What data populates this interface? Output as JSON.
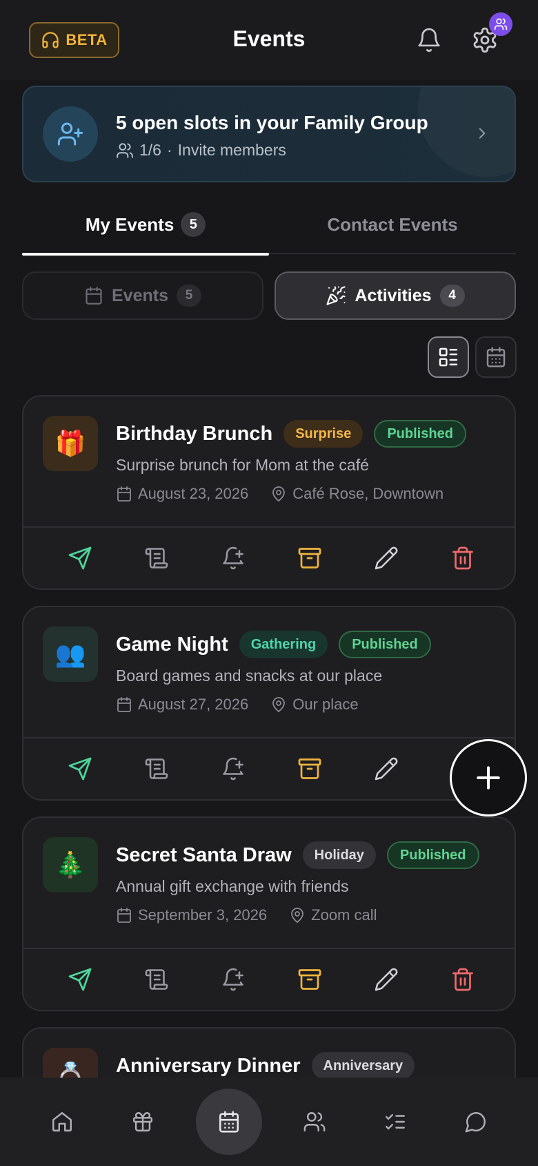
{
  "header": {
    "beta_label": "BETA",
    "title": "Events",
    "icons": [
      "headset-icon",
      "bell-icon",
      "gear-icon",
      "users-badge-icon"
    ]
  },
  "banner": {
    "title": "5 open slots in your Family Group",
    "count": "1/6",
    "separator": "·",
    "link": "Invite members"
  },
  "tabs": [
    {
      "label": "My Events",
      "count": "5",
      "active": true
    },
    {
      "label": "Contact Events",
      "active": false
    }
  ],
  "segments": [
    {
      "label": "Events",
      "count": "5",
      "active": false
    },
    {
      "label": "Activities",
      "count": "4",
      "active": true
    }
  ],
  "view_toggle": {
    "selected": "list",
    "options": [
      "list",
      "calendar"
    ]
  },
  "cards": [
    {
      "emoji": "🎁",
      "title": "Birthday Brunch",
      "category": "Surprise",
      "status": "Published",
      "description": "Surprise brunch for Mom at the café",
      "date": "August 23, 2026",
      "location": "Café Rose, Downtown"
    },
    {
      "emoji": "👥",
      "title": "Game Night",
      "category": "Gathering",
      "status": "Published",
      "description": "Board games and snacks at our place",
      "date": "August 27, 2026",
      "location": "Our place"
    },
    {
      "emoji": "🎄",
      "title": "Secret Santa Draw",
      "category": "Holiday",
      "status": "Published",
      "description": "Annual gift exchange with friends",
      "date": "September 3, 2026",
      "location": "Zoom call"
    },
    {
      "emoji": "💍",
      "title": "Anniversary Dinner",
      "category": "Anniversary"
    }
  ],
  "card_actions": [
    "send",
    "receipt",
    "reminder",
    "archive",
    "edit",
    "delete"
  ],
  "bottom_nav": [
    {
      "name": "home",
      "active": false
    },
    {
      "name": "gifts",
      "active": false
    },
    {
      "name": "events",
      "active": true
    },
    {
      "name": "contacts",
      "active": false
    },
    {
      "name": "tasks",
      "active": false
    },
    {
      "name": "chat",
      "active": false
    }
  ],
  "colors": {
    "background": "#17171a",
    "accent_gold": "#f0b43c",
    "published_green": "#5fd494",
    "delete_red": "#f06a6a",
    "send_green": "#4fd69a",
    "archive_gold": "#f0b43c",
    "badge_purple": "#7c4de8"
  }
}
